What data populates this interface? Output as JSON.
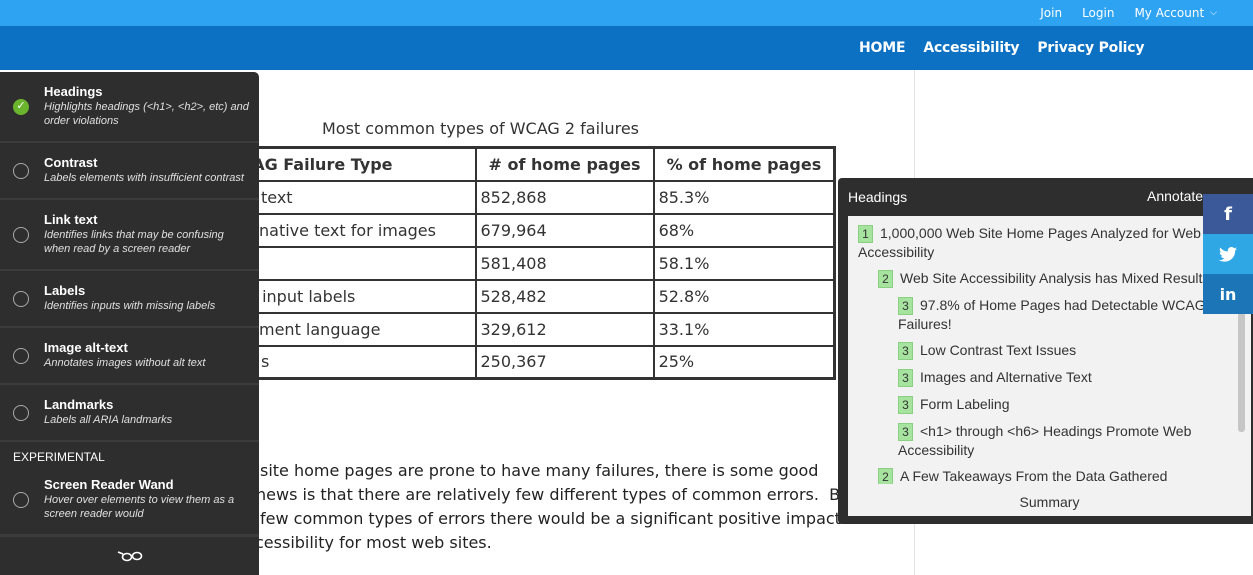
{
  "topbar": {
    "links": [
      "Join",
      "Login",
      "My Account"
    ],
    "account_chevron": "⌄"
  },
  "nav": {
    "items": [
      "HOME",
      "Accessibility",
      "Privacy Policy"
    ]
  },
  "table": {
    "caption": "Most common types of WCAG 2 failures",
    "headers": [
      "AG Failure Type",
      "# of home pages",
      "% of home pages"
    ],
    "rows": [
      [
        "text",
        "852,868",
        "85.3%"
      ],
      [
        "native text for images",
        "679,964",
        "68%"
      ],
      [
        "",
        "581,408",
        "58.1%"
      ],
      [
        " input labels",
        "528,482",
        "52.8%"
      ],
      [
        "ment language",
        "329,612",
        "33.1%"
      ],
      [
        "s",
        "250,367",
        "25%"
      ]
    ]
  },
  "article": {
    "lines": [
      "site home pages are prone to have many failures, there is some good",
      "news is that there are relatively few different types of common errors.  B",
      "few common types of errors there would be a significant positive impact",
      "cessibility for most web sites."
    ]
  },
  "tools": {
    "items": [
      {
        "title": "Headings",
        "desc": "Highlights headings (<h1>, <h2>, etc) and order violations",
        "checked": true
      },
      {
        "title": "Contrast",
        "desc": "Labels elements with insufficient contrast",
        "checked": false
      },
      {
        "title": "Link text",
        "desc": "Identifies links that may be confusing when read by a screen reader",
        "checked": false
      },
      {
        "title": "Labels",
        "desc": "Identifies inputs with missing labels",
        "checked": false
      },
      {
        "title": "Image alt-text",
        "desc": "Annotates images without alt text",
        "checked": false
      },
      {
        "title": "Landmarks",
        "desc": "Labels all ARIA landmarks",
        "checked": false
      }
    ],
    "section_label": "EXPERIMENTAL",
    "experimental": [
      {
        "title": "Screen Reader Wand",
        "desc": "Hover over elements to view them as a screen reader would",
        "checked": false
      }
    ],
    "footer_icon": "glasses-icon",
    "check_glyph": "✓"
  },
  "headings_panel": {
    "title": "Headings",
    "annotate_label": "Annotate",
    "items": [
      {
        "level": "1",
        "text": "1,000,000 Web Site Home Pages Analyzed for Web Accessibility"
      },
      {
        "level": "2",
        "text": "Web Site Accessibility Analysis has Mixed Results"
      },
      {
        "level": "3",
        "text": "97.8% of Home Pages had Detectable WCAG 2 Failures!"
      },
      {
        "level": "3",
        "text": "Low Contrast Text Issues"
      },
      {
        "level": "3",
        "text": "Images and Alternative Text"
      },
      {
        "level": "3",
        "text": "Form Labeling"
      },
      {
        "level": "3",
        "text": "<h1> through <h6> Headings Promote Web Accessibility"
      },
      {
        "level": "2",
        "text": "A Few Takeaways From the Data Gathered"
      }
    ],
    "summary_label": "Summary"
  },
  "social": {
    "facebook": "f",
    "twitter": "🐦",
    "linkedin": "in"
  }
}
